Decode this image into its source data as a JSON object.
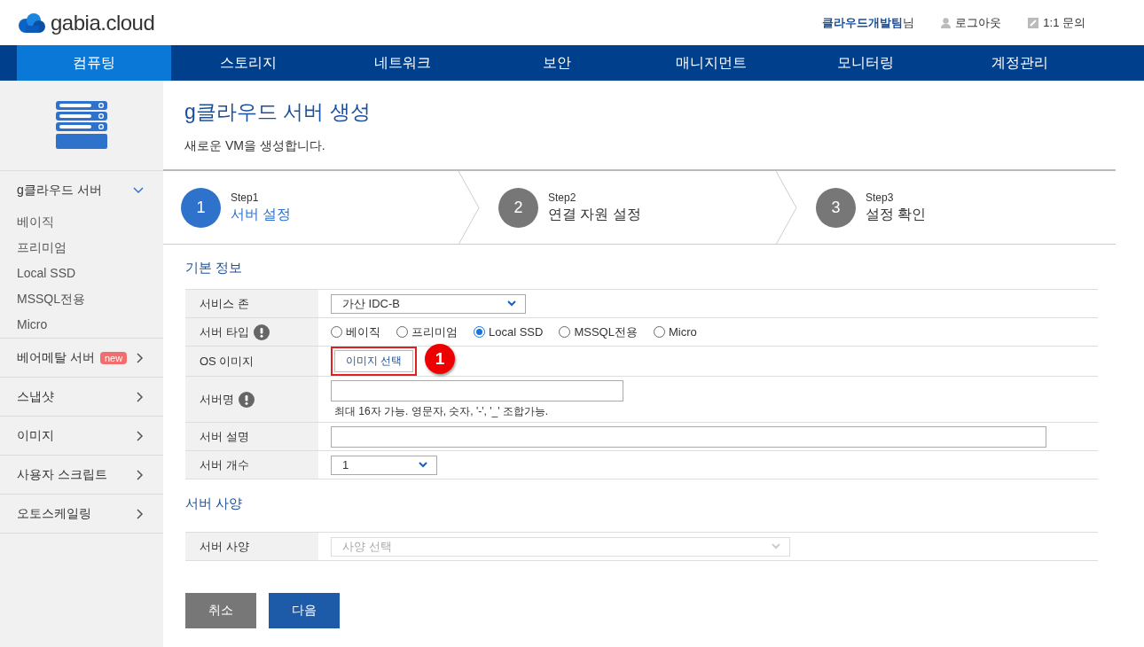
{
  "logo": "gabia.cloud",
  "header_links": {
    "user": "클라우드개발팀",
    "user_suffix": "님",
    "logout": "로그아웃",
    "inquiry": "1:1 문의"
  },
  "nav": [
    {
      "label": "컴퓨팅",
      "selected": true
    },
    {
      "label": "스토리지",
      "selected": false
    },
    {
      "label": "네트워크",
      "selected": false
    },
    {
      "label": "보안",
      "selected": false
    },
    {
      "label": "매니지먼트",
      "selected": false
    },
    {
      "label": "모니터링",
      "selected": false
    },
    {
      "label": "계정관리",
      "selected": false
    }
  ],
  "sidebar": [
    {
      "label": "g클라우드 서버",
      "expanded": true,
      "children": [
        {
          "label": "베이직"
        },
        {
          "label": "프리미엄"
        },
        {
          "label": "Local SSD"
        },
        {
          "label": "MSSQL전용"
        },
        {
          "label": "Micro"
        }
      ]
    },
    {
      "label": "베어메탈 서버",
      "badge": "new",
      "expanded": false
    },
    {
      "label": "스냅샷",
      "expanded": false
    },
    {
      "label": "이미지",
      "expanded": false
    },
    {
      "label": "사용자 스크립트",
      "expanded": false
    },
    {
      "label": "오토스케일링",
      "expanded": false
    }
  ],
  "page": {
    "title": "g클라우드 서버 생성",
    "subtitle": "새로운 VM을 생성합니다."
  },
  "steps": [
    {
      "number": "1",
      "step": "Step1",
      "label": "서버 설정",
      "selected": true
    },
    {
      "number": "2",
      "step": "Step2",
      "label": "연결 자원 설정",
      "selected": false
    },
    {
      "number": "3",
      "step": "Step3",
      "label": "설정 확인",
      "selected": false
    }
  ],
  "sections": [
    {
      "title": "기본 정보",
      "rows": [
        {
          "kind": "select",
          "label": "서비스 존",
          "value": "가산 IDC-B"
        },
        {
          "kind": "radio",
          "label": "서버 타입",
          "info": true,
          "options": [
            {
              "label": "베이직",
              "selected": false
            },
            {
              "label": "프리미엄",
              "selected": false
            },
            {
              "label": "Local SSD",
              "selected": true
            },
            {
              "label": "MSSQL전용",
              "selected": false
            },
            {
              "label": "Micro",
              "selected": false
            }
          ]
        },
        {
          "kind": "button",
          "label": "OS 이미지",
          "button": "이미지 선택",
          "highlighted": true,
          "callout": "1"
        },
        {
          "kind": "text",
          "label": "서버명",
          "info": true,
          "hint": "최대 16자 가능. 영문자, 숫자, '-', '_' 조합가능."
        },
        {
          "kind": "text",
          "label": "서버 설명"
        },
        {
          "kind": "select",
          "label": "서버 개수",
          "value": "1"
        }
      ]
    },
    {
      "title": "서버 사양",
      "rows": [
        {
          "kind": "select",
          "label": "서버 사양",
          "placeholder": "사양 선택",
          "disabled": true
        }
      ]
    }
  ],
  "actions": [
    {
      "label": "취소",
      "kind": "secondary"
    },
    {
      "label": "다음",
      "kind": "primary"
    }
  ]
}
